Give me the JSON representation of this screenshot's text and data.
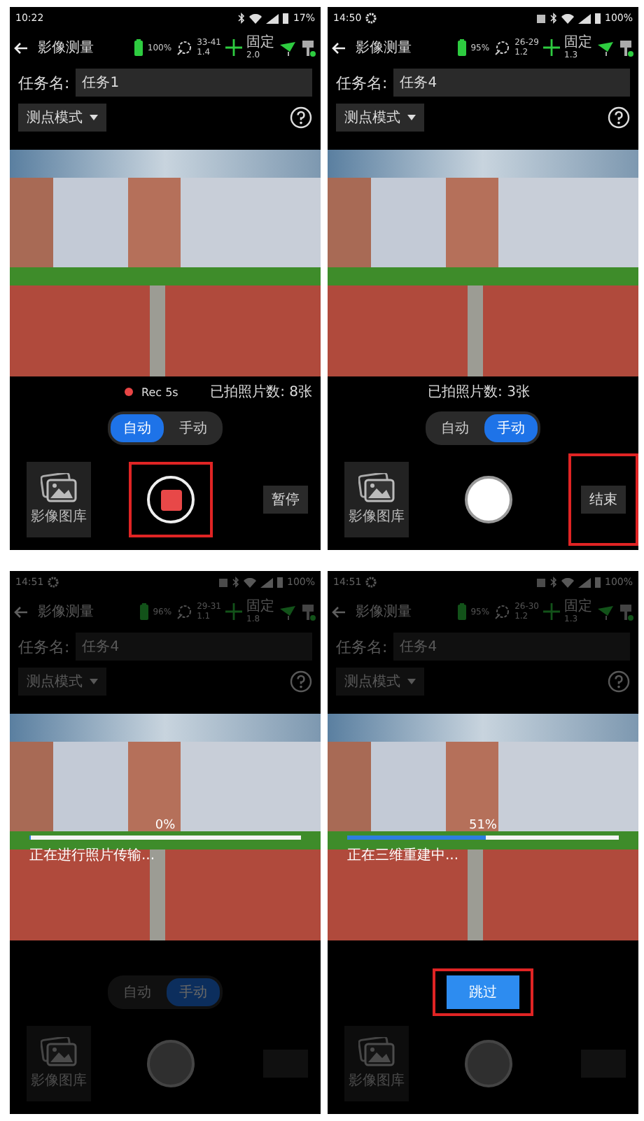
{
  "panels": [
    {
      "dimmed": false,
      "status_bar": {
        "time": "10:22",
        "settings_icon": false,
        "notification_icon": false,
        "battery": "17%"
      },
      "app_bar": {
        "title": "影像测量",
        "battery": "100%",
        "satellites": "33-41",
        "satellite_value": "1.4",
        "fix": "固定",
        "fix_value": "2.0"
      },
      "task": {
        "label": "任务名:",
        "value": "任务1"
      },
      "mode": {
        "label": "测点模式"
      },
      "recording": {
        "label": "Rec 5s"
      },
      "photo_count": "已拍照片数: 8张",
      "toggle": [
        {
          "label": "自动",
          "selected": true
        },
        {
          "label": "手动",
          "selected": false
        }
      ],
      "gallery": {
        "label": "影像图库"
      },
      "shutter": {
        "kind": "recording",
        "highlighted": true
      },
      "side_button": {
        "label": "暂停",
        "highlighted": false
      }
    },
    {
      "dimmed": false,
      "status_bar": {
        "time": "14:50",
        "settings_icon": true,
        "notification_icon": true,
        "battery": "100%"
      },
      "app_bar": {
        "title": "影像测量",
        "battery": "95%",
        "satellites": "26-29",
        "satellite_value": "1.2",
        "fix": "固定",
        "fix_value": "1.3"
      },
      "task": {
        "label": "任务名:",
        "value": "任务4"
      },
      "mode": {
        "label": "测点模式"
      },
      "photo_count": "已拍照片数: 3张",
      "toggle": [
        {
          "label": "自动",
          "selected": false
        },
        {
          "label": "手动",
          "selected": true
        }
      ],
      "gallery": {
        "label": "影像图库"
      },
      "shutter": {
        "kind": "ready",
        "highlighted": false
      },
      "side_button": {
        "label": "结束",
        "highlighted": true
      }
    },
    {
      "dimmed": true,
      "status_bar": {
        "time": "14:51",
        "settings_icon": true,
        "notification_icon": true,
        "battery": "100%"
      },
      "app_bar": {
        "title": "影像测量",
        "battery": "96%",
        "satellites": "29-31",
        "satellite_value": "1.1",
        "fix": "固定",
        "fix_value": "1.8"
      },
      "task": {
        "label": "任务名:",
        "value": "任务4"
      },
      "mode": {
        "label": "测点模式"
      },
      "progress": {
        "percent": "0%",
        "level": 0,
        "message": "正在进行照片传输..."
      },
      "toggle": [
        {
          "label": "自动",
          "selected": false
        },
        {
          "label": "手动",
          "selected": true
        }
      ],
      "gallery": {
        "label": "影像图库"
      },
      "shutter": {
        "kind": "disabled",
        "highlighted": false
      },
      "side_button": {
        "highlighted": false
      }
    },
    {
      "dimmed": true,
      "status_bar": {
        "time": "14:51",
        "settings_icon": true,
        "notification_icon": true,
        "battery": "100%"
      },
      "app_bar": {
        "title": "影像测量",
        "battery": "95%",
        "satellites": "26-30",
        "satellite_value": "1.2",
        "fix": "固定",
        "fix_value": "1.3"
      },
      "task": {
        "label": "任务名:",
        "value": "任务4"
      },
      "mode": {
        "label": "测点模式"
      },
      "progress": {
        "percent": "51%",
        "level": 0.51,
        "message": "正在三维重建中..."
      },
      "skip_button": {
        "label": "跳过",
        "highlighted": true
      },
      "gallery": {
        "label": "影像图库"
      },
      "shutter": {
        "kind": "disabled",
        "highlighted": false
      },
      "side_button": {
        "highlighted": false
      }
    }
  ]
}
